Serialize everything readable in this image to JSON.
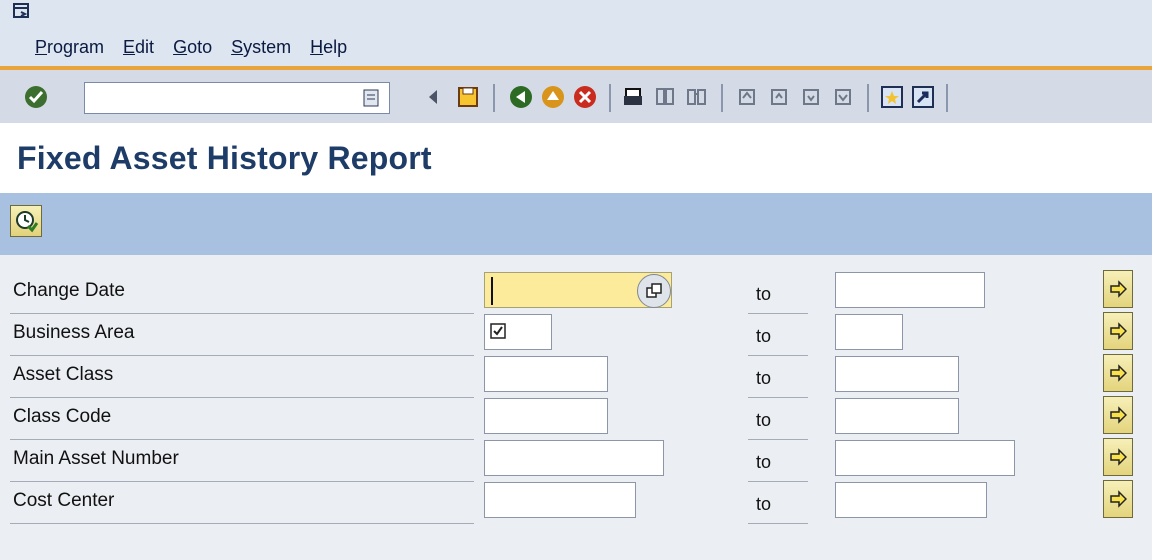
{
  "menu": {
    "items": [
      "Program",
      "Edit",
      "Goto",
      "System",
      "Help"
    ]
  },
  "toolbar": {
    "command_value": "",
    "icons": [
      "check-icon",
      "list-icon",
      "back-triangle-icon",
      "save-icon",
      "back-icon",
      "exit-icon",
      "cancel-icon",
      "print-icon",
      "find-icon",
      "find-next-icon",
      "first-page-icon",
      "prev-page-icon",
      "next-page-icon",
      "last-page-icon",
      "new-session-icon",
      "shortcut-icon"
    ]
  },
  "page": {
    "title": "Fixed Asset History Report"
  },
  "form": {
    "to_label": "to",
    "rows": [
      {
        "label": "Change Date"
      },
      {
        "label": "Business Area"
      },
      {
        "label": "Asset Class"
      },
      {
        "label": "Class Code"
      },
      {
        "label": "Main Asset Number"
      },
      {
        "label": "Cost Center"
      }
    ]
  },
  "colors": {
    "accent_orange": "#e8a53c",
    "title_blue": "#1e3c68",
    "app_toolbar": "#a8c1e1",
    "focus_field": "#fbeb9b"
  }
}
